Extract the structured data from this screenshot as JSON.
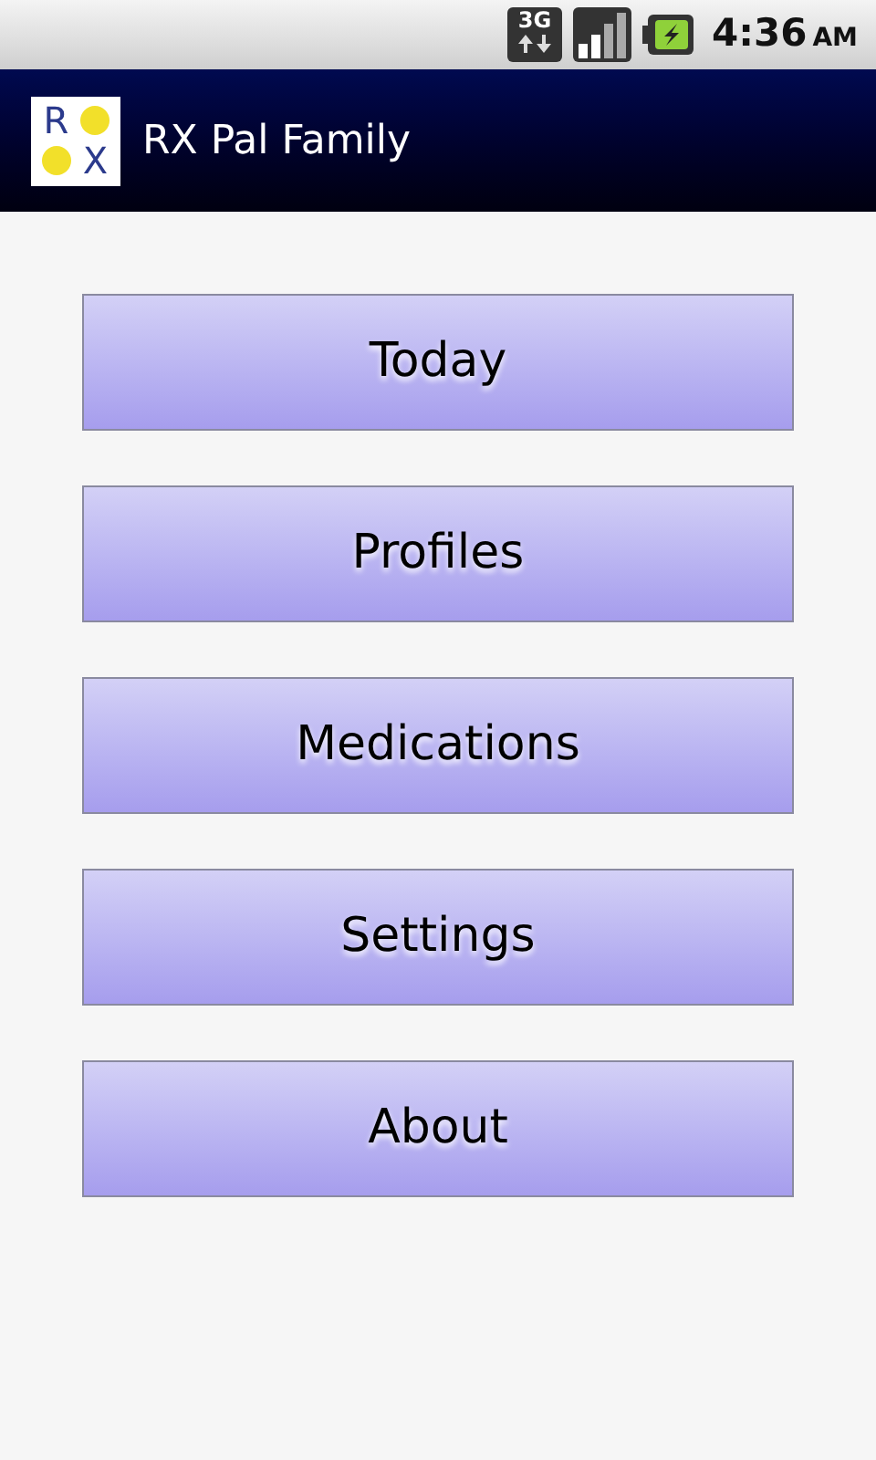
{
  "status_bar": {
    "network": "3G",
    "time": "4:36",
    "period": "AM"
  },
  "title_bar": {
    "logo": {
      "letters": [
        "R",
        "X"
      ]
    },
    "title": "RX Pal Family"
  },
  "menu": [
    {
      "label": "Today"
    },
    {
      "label": "Profiles"
    },
    {
      "label": "Medications"
    },
    {
      "label": "Settings"
    },
    {
      "label": "About"
    }
  ]
}
